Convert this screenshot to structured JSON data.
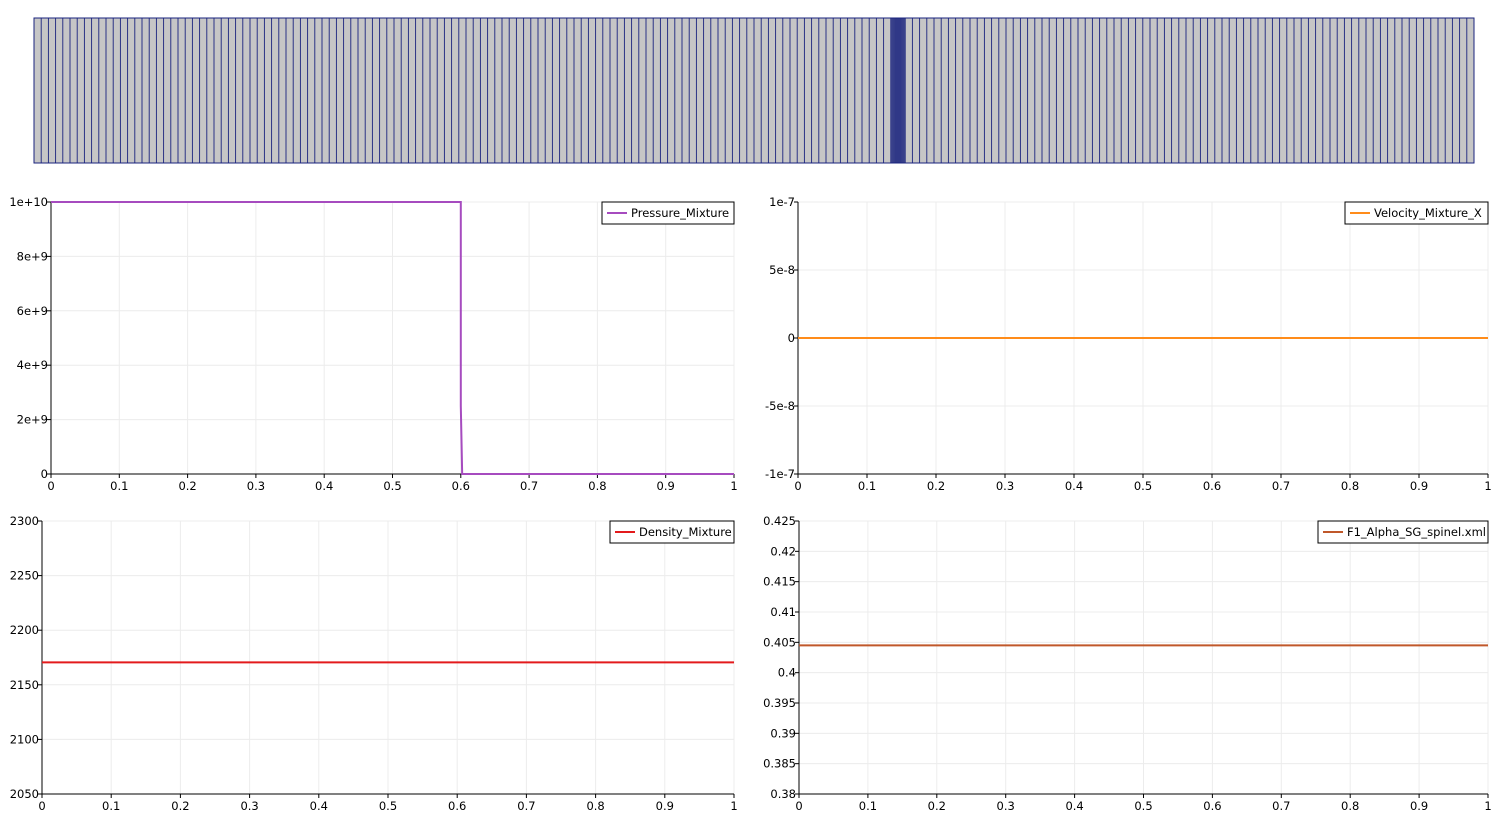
{
  "mesh": {
    "fill_color": "#c6c6c6",
    "edge_color": "#1a237e",
    "refined_region": [
      0.595,
      0.605
    ]
  },
  "chart_data": [
    {
      "id": "plot-pressure",
      "type": "line",
      "xlim": [
        0,
        1
      ],
      "ylim": [
        0,
        10000000000
      ],
      "xticks": [
        "0",
        "0.1",
        "0.2",
        "0.3",
        "0.4",
        "0.5",
        "0.6",
        "0.7",
        "0.8",
        "0.9",
        "1"
      ],
      "yticks": [
        "0",
        "2e+9",
        "4e+9",
        "6e+9",
        "8e+9",
        "1e+10"
      ],
      "grid": true,
      "legend_position": "top-right",
      "series": [
        {
          "name": "Pressure_Mixture",
          "color": "#a64bbf",
          "x": [
            0,
            0.6,
            0.6,
            0.602,
            1
          ],
          "y": [
            10000000000,
            10000000000,
            2500000000,
            0,
            0
          ]
        }
      ]
    },
    {
      "id": "plot-velocity",
      "type": "line",
      "xlim": [
        0,
        1
      ],
      "ylim": [
        -1e-07,
        1e-07
      ],
      "xticks": [
        "0",
        "0.1",
        "0.2",
        "0.3",
        "0.4",
        "0.5",
        "0.6",
        "0.7",
        "0.8",
        "0.9",
        "1"
      ],
      "yticks": [
        "-1e-7",
        "-5e-8",
        "0",
        "5e-8",
        "1e-7"
      ],
      "grid": true,
      "legend_position": "top-right",
      "series": [
        {
          "name": "Velocity_Mixture_X",
          "color": "#ff8c1a",
          "x": [
            0,
            1
          ],
          "y": [
            0,
            0
          ]
        }
      ]
    },
    {
      "id": "plot-density",
      "type": "line",
      "xlim": [
        0,
        1
      ],
      "ylim": [
        2050,
        2300
      ],
      "xticks": [
        "0",
        "0.1",
        "0.2",
        "0.3",
        "0.4",
        "0.5",
        "0.6",
        "0.7",
        "0.8",
        "0.9",
        "1"
      ],
      "yticks": [
        "2050",
        "2100",
        "2150",
        "2200",
        "2250",
        "2300"
      ],
      "grid": true,
      "legend_position": "top-right",
      "series": [
        {
          "name": "Density_Mixture",
          "color": "#e31a1c",
          "x": [
            0,
            1
          ],
          "y": [
            2170.5,
            2170.5
          ]
        }
      ]
    },
    {
      "id": "plot-alpha",
      "type": "line",
      "xlim": [
        0,
        1
      ],
      "ylim": [
        0.38,
        0.425
      ],
      "xticks": [
        "0",
        "0.1",
        "0.2",
        "0.3",
        "0.4",
        "0.5",
        "0.6",
        "0.7",
        "0.8",
        "0.9",
        "1"
      ],
      "yticks": [
        "0.38",
        "0.385",
        "0.39",
        "0.395",
        "0.4",
        "0.405",
        "0.41",
        "0.415",
        "0.42",
        "0.425"
      ],
      "grid": true,
      "legend_position": "top-right",
      "series": [
        {
          "name": "F1_Alpha_SG_spinel.xml",
          "color": "#c0582a",
          "x": [
            0,
            1
          ],
          "y": [
            0.4045,
            0.4045
          ]
        }
      ]
    }
  ]
}
